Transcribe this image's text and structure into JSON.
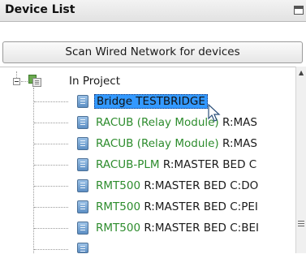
{
  "panel": {
    "title": "Device List",
    "scan_button": "Scan Wired Network for devices"
  },
  "tree": {
    "root_label": "In Project",
    "items": [
      {
        "name": "Bridge TESTBRIDGE",
        "location": "",
        "selected": true
      },
      {
        "name": "RACUB (Relay Module)",
        "location": " R:MAS"
      },
      {
        "name": "RACUB (Relay Module)",
        "location": " R:MAS"
      },
      {
        "name": "RACUB-PLM",
        "location": " R:MASTER BED C"
      },
      {
        "name": "RMT500",
        "location": " R:MASTER BED C:DO"
      },
      {
        "name": "RMT500",
        "location": " R:MASTER BED C:PEI"
      },
      {
        "name": "RMT500",
        "location": " R:MASTER BED C:BEI"
      }
    ]
  },
  "icons": {
    "expander": "minus-expander-icon",
    "project": "project-folder-icon",
    "device": "device-module-icon",
    "cursor": "mouse-pointer-icon"
  },
  "colors": {
    "selection": "#3399ff",
    "device_name_green": "#2d8c2d"
  }
}
